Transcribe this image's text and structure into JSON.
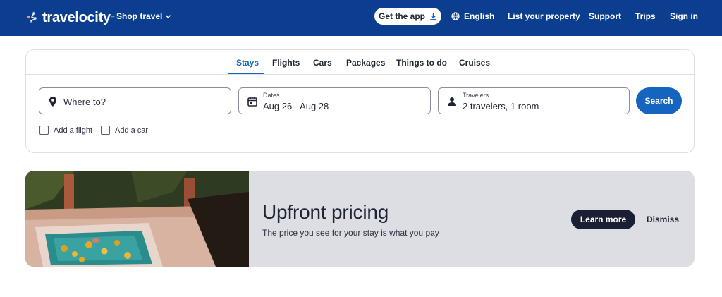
{
  "header": {
    "logo_text": "travelocity",
    "logo_icon": "star-icon",
    "shop_travel": "Shop travel",
    "get_app": "Get the app",
    "language": "English",
    "list_property": "List your property",
    "support": "Support",
    "trips": "Trips",
    "sign_in": "Sign in",
    "bg_color": "#0b3e8f"
  },
  "tabs": [
    {
      "label": "Stays",
      "active": true
    },
    {
      "label": "Flights",
      "active": false
    },
    {
      "label": "Cars",
      "active": false
    },
    {
      "label": "Packages",
      "active": false
    },
    {
      "label": "Things to do",
      "active": false
    },
    {
      "label": "Cruises",
      "active": false
    }
  ],
  "search": {
    "destination_placeholder": "Where to?",
    "dates_label": "Dates",
    "dates_value": "Aug 26 - Aug 28",
    "travelers_label": "Travelers",
    "travelers_value": "2 travelers, 1 room",
    "search_button": "Search",
    "add_flight": "Add a flight",
    "add_car": "Add a car",
    "accent_color": "#1565c0"
  },
  "promo": {
    "title": "Upfront pricing",
    "subtitle": "The price you see for your stay is what you pay",
    "learn_more": "Learn more",
    "dismiss": "Dismiss"
  }
}
